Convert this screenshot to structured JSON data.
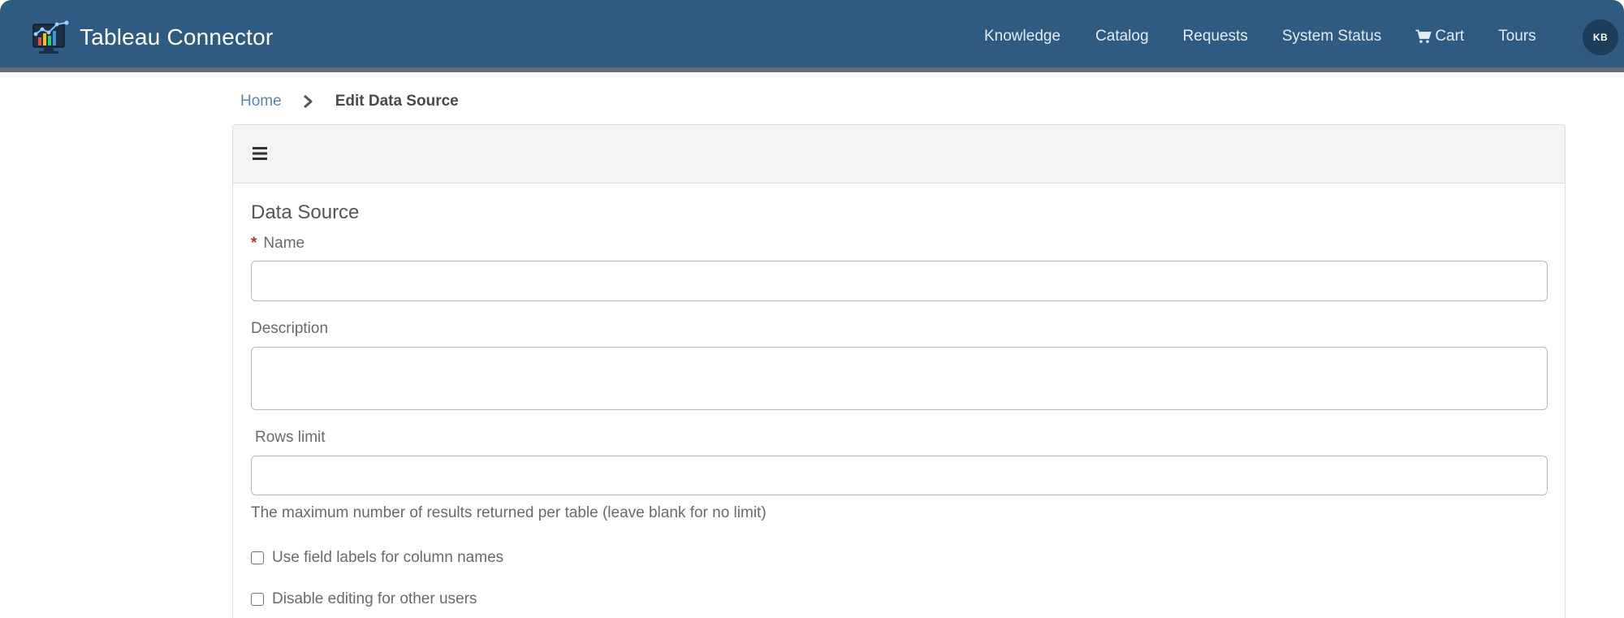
{
  "header": {
    "brand_name": "Tableau Connector",
    "logo_icon": "tableau-connector-logo",
    "nav": [
      {
        "label": "Knowledge"
      },
      {
        "label": "Catalog"
      },
      {
        "label": "Requests"
      },
      {
        "label": "System Status"
      },
      {
        "label": "Cart",
        "icon": "cart-icon"
      },
      {
        "label": "Tours"
      }
    ],
    "avatar_initials": "KB"
  },
  "breadcrumb": {
    "home": "Home",
    "current": "Edit Data Source"
  },
  "form": {
    "section_title": "Data Source",
    "name": {
      "label": "Name",
      "required_marker": "*",
      "value": ""
    },
    "description": {
      "label": "Description",
      "value": ""
    },
    "rows_limit": {
      "label": "Rows limit",
      "value": "",
      "help": "The maximum number of results returned per table (leave blank for no limit)"
    },
    "checkboxes": [
      {
        "label": "Use field labels for column names",
        "checked": false
      },
      {
        "label": "Disable editing for other users",
        "checked": false
      }
    ]
  },
  "colors": {
    "header_bg": "#2f5a82",
    "header_bottom_border": "#6a6e73",
    "avatar_bg": "#1e3d5c",
    "link": "#5b86ad",
    "required": "#b03a2e"
  }
}
